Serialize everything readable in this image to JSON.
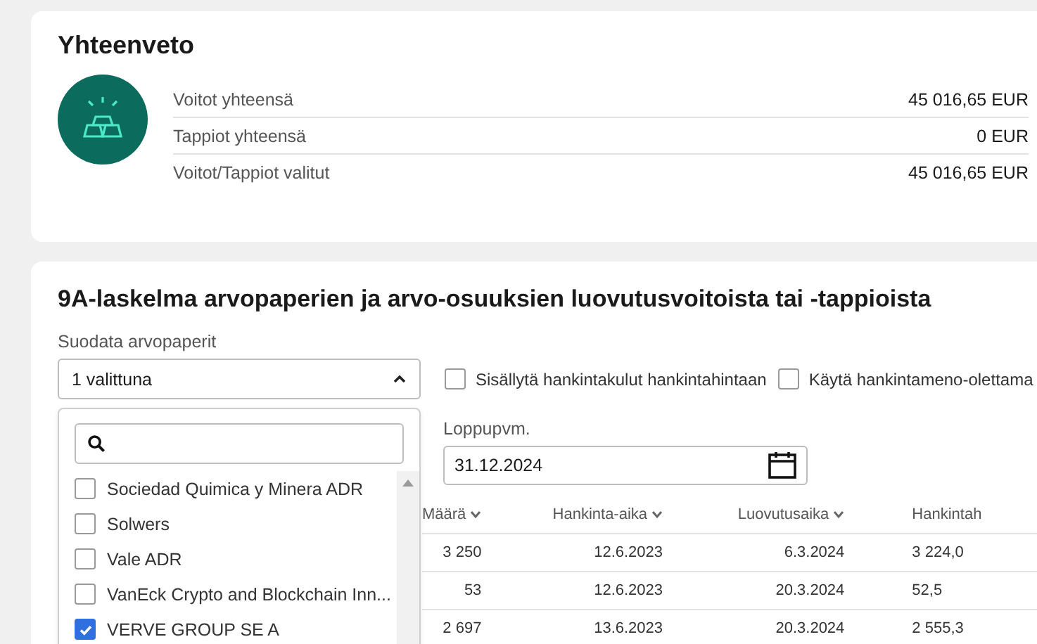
{
  "summary": {
    "title": "Yhteenveto",
    "rows": [
      {
        "label": "Voitot yhteensä",
        "value": "45 016,65 EUR"
      },
      {
        "label": "Tappiot yhteensä",
        "value": "0 EUR"
      },
      {
        "label": "Voitot/Tappiot valitut",
        "value": "45 016,65 EUR"
      }
    ]
  },
  "report": {
    "title": "9A-laskelma arvopaperien ja arvo-osuuksien luovutusvoitoista tai -tappioista",
    "filter": {
      "label": "Suodata arvopaperit",
      "value": "1 valittuna",
      "expanded": true,
      "options": [
        {
          "label": "Sociedad Quimica y Minera ADR",
          "checked": false
        },
        {
          "label": "Solwers",
          "checked": false
        },
        {
          "label": "Vale ADR",
          "checked": false
        },
        {
          "label": "VanEck Crypto and Blockchain Inn...",
          "checked": false
        },
        {
          "label": "VERVE GROUP SE A",
          "checked": true
        }
      ]
    },
    "options": [
      {
        "label": "Sisällytä hankintakulut hankintahintaan",
        "checked": false
      },
      {
        "label": "Käytä hankintameno-olettama",
        "checked": false
      }
    ],
    "end_date": {
      "label": "Loppupvm.",
      "value": "31.12.2024"
    },
    "table": {
      "columns": [
        {
          "label": "Määrä",
          "sortable": true
        },
        {
          "label": "Hankinta-aika",
          "sortable": true
        },
        {
          "label": "Luovutusaika",
          "sortable": true
        },
        {
          "label": "Hankintah",
          "sortable": false
        }
      ],
      "rows": [
        [
          "3 250",
          "12.6.2023",
          "6.3.2024",
          "3 224,0"
        ],
        [
          "53",
          "12.6.2023",
          "20.3.2024",
          "52,5"
        ],
        [
          "2 697",
          "13.6.2023",
          "20.3.2024",
          "2 555,3"
        ]
      ]
    }
  }
}
